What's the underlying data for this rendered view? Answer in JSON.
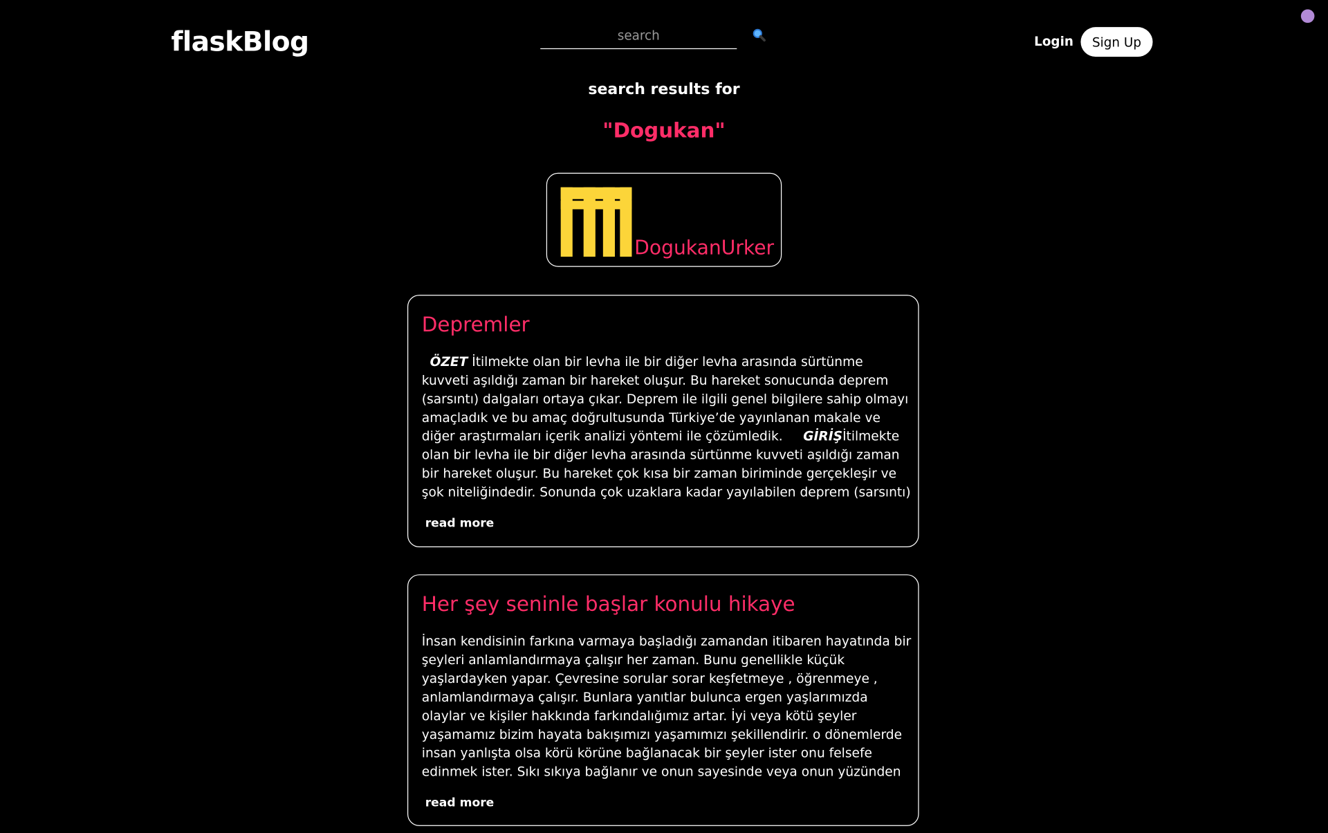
{
  "header": {
    "logo": "flaskBlog",
    "search_placeholder": "search",
    "login_label": "Login",
    "signup_label": "Sign Up"
  },
  "results": {
    "label": "search results for",
    "query": "\"Dogukan\""
  },
  "users": [
    {
      "username": "DogukanUrker",
      "avatar_color": "#fcd539"
    }
  ],
  "posts": [
    {
      "title": "Depremler",
      "body_lead_bold": "ÖZET",
      "body_part1": " İtilmekte olan bir levha ile bir diğer levha arasında sürtünme kuvveti aşıldığı zaman bir hareket oluşur. Bu hareket sonucunda deprem (sarsıntı) dalgaları ortaya çıkar. Deprem ile ilgili genel bilgilere sahip olmayı amaçladık ve bu amaç doğrultusunda Türkiye’de yayınlanan makale ve diğer araştırmaları içerik analizi yöntemi ile çözümledik.",
      "body_mid_bold": "GİRİŞ",
      "body_part2": "İtilmekte olan bir levha ile bir diğer levha arasında sürtünme kuvveti aşıldığı zaman bir hareket oluşur. Bu hareket çok kısa bir zaman biriminde gerçekleşir ve şok niteliğindedir. Sonunda çok uzaklara kadar yayılabilen deprem (sarsıntı) dalgaları ortaya çıkar. Deprem...",
      "read_more": "read more"
    },
    {
      "title": "Her şey seninle başlar konulu hikaye",
      "body": "İnsan kendisinin farkına varmaya başladığı zamandan itibaren hayatında bir şeyleri anlamlandırmaya çalışır her zaman. Bunu genellikle küçük yaşlardayken yapar. Çevresine sorular sorar keşfetmeye , öğrenmeye , anlamlandırmaya çalışır. Bunlara yanıtlar bulunca ergen yaşlarımızda olaylar ve kişiler hakkında farkındalığımız artar. İyi veya kötü şeyler yaşamamız bizim hayata bakışımızı yaşamımızı şekillendirir. o dönemlerde insan yanlışta olsa körü körüne bağlanacak bir şeyler ister onu felsefe edinmek ister. Sıkı sıkıya bağlanır ve onun sayesinde veya onun yüzünden diyecek bir başlangıç cümlesi edinir....",
      "read_more": "read more"
    }
  ],
  "colors": {
    "background": "#000000",
    "accent": "#ff2d68",
    "text": "#ffffff",
    "avatar": "#fcd539",
    "theme_toggle": "#b28ad6"
  },
  "icons": {
    "search": "magnifier-icon",
    "theme": "theme-toggle-icon"
  }
}
